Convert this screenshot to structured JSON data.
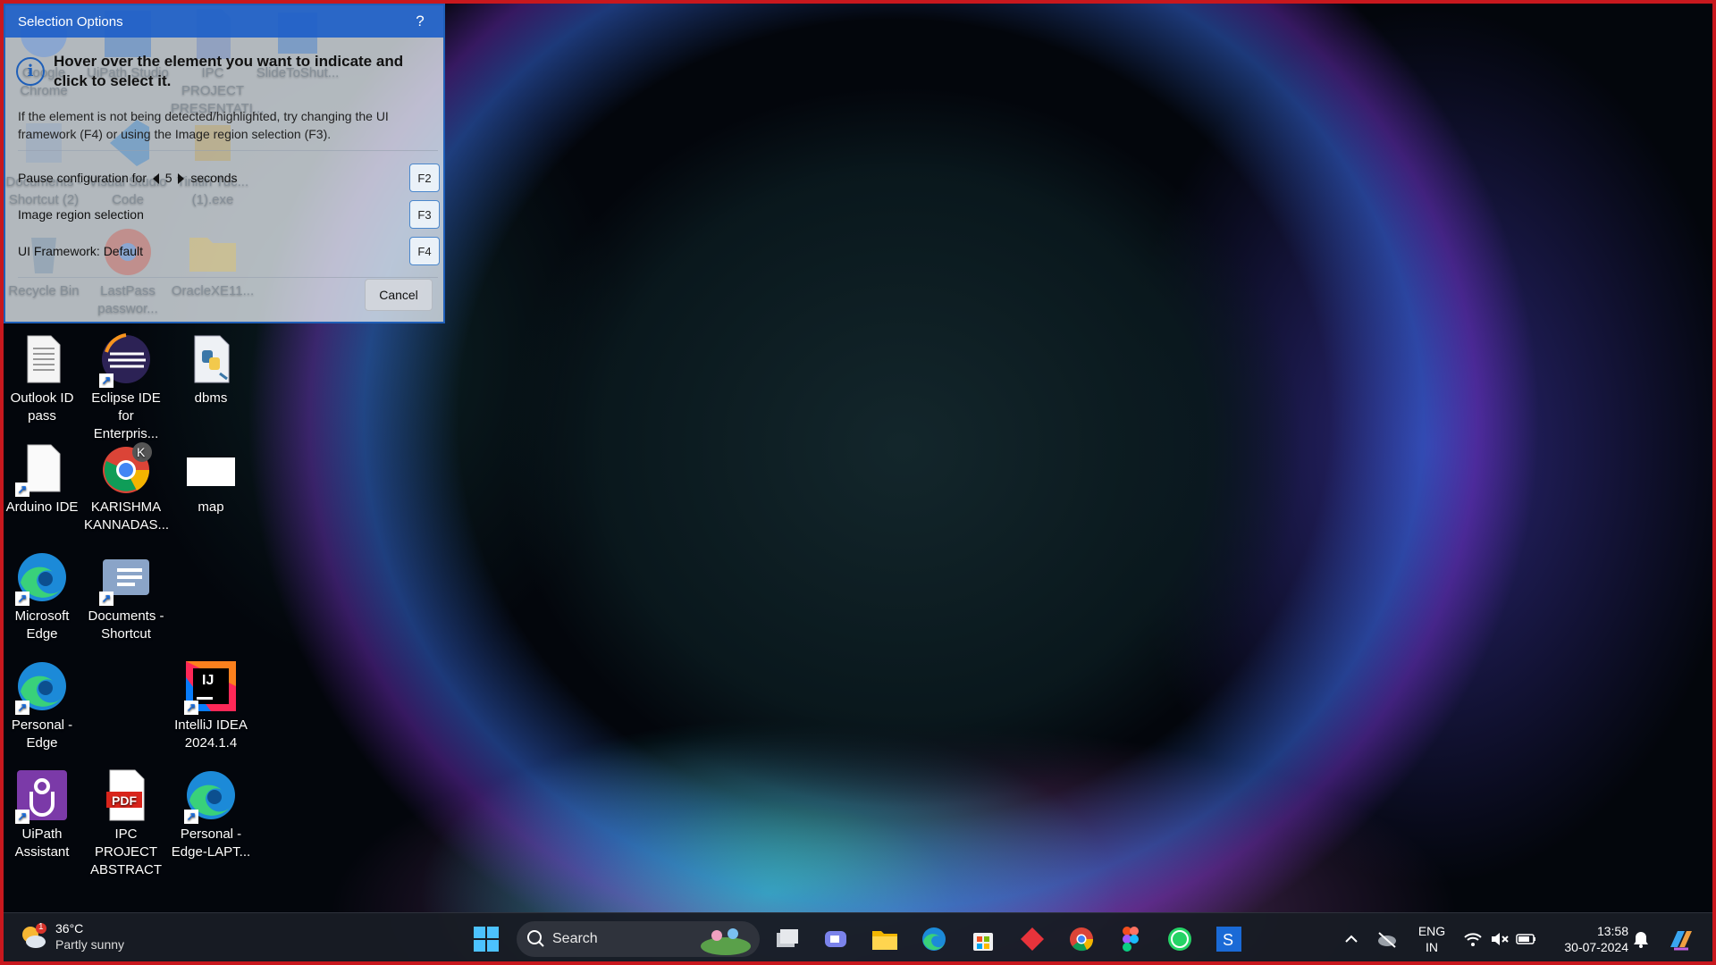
{
  "desktop": {
    "icons": [
      {
        "label": "Google Chrome",
        "icon": "chrome-icon"
      },
      {
        "label": "UiPath Studio",
        "icon": "uipath-studio-icon"
      },
      {
        "label": "IPC PROJECT PRESENTATI...",
        "icon": "pdf-icon"
      },
      {
        "label": "SlideToShut...",
        "icon": "app-icon"
      },
      {
        "label": "Documents - Shortcut (2)",
        "icon": "document-icon"
      },
      {
        "label": "Visual Studio Code",
        "icon": "vscode-icon"
      },
      {
        "label": "Tinitiri Tuc... (1).exe",
        "icon": "exe-icon"
      },
      {
        "label": "Recycle Bin",
        "icon": "recycle-bin-icon"
      },
      {
        "label": "LastPass passwor...",
        "icon": "chrome-icon"
      },
      {
        "label": "OracleXE11...",
        "icon": "folder-icon"
      },
      {
        "label": "Outlook ID pass",
        "icon": "text-file-icon"
      },
      {
        "label": "Eclipse IDE for Enterpris...",
        "icon": "eclipse-icon"
      },
      {
        "label": "dbms",
        "icon": "python-file-icon"
      },
      {
        "label": "Arduino IDE",
        "icon": "blank-file-icon"
      },
      {
        "label": "KARISHMA KANNADAS...",
        "icon": "chrome-profile-icon"
      },
      {
        "label": "map",
        "icon": "image-file-icon"
      },
      {
        "label": "Microsoft Edge",
        "icon": "edge-icon"
      },
      {
        "label": "Documents - Shortcut",
        "icon": "documents-folder-icon"
      },
      {
        "label": "Personal - Edge",
        "icon": "edge-icon"
      },
      {
        "label": "IntelliJ IDEA 2024.1.4",
        "icon": "intellij-icon"
      },
      {
        "label": "UiPath Assistant",
        "icon": "uipath-assistant-icon"
      },
      {
        "label": "IPC PROJECT ABSTRACT",
        "icon": "pdf-icon"
      },
      {
        "label": "Personal - Edge-LAPT...",
        "icon": "edge-icon"
      }
    ],
    "pdf_badge": "PDF",
    "intellij_badge": "IJ",
    "profile_badge": "K"
  },
  "dialog": {
    "title": "Selection Options",
    "help": "?",
    "instruction": "Hover over the element you want to indicate and click to select it.",
    "note": "If the element is not being detected/highlighted, try changing the UI framework (F4) or using the Image region selection (F3).",
    "pause_label": "Pause configuration for",
    "pause_value": "5",
    "pause_unit": "seconds",
    "pause_key": "F2",
    "image_region_label": "Image region selection",
    "image_region_key": "F3",
    "framework_label": "UI Framework:",
    "framework_value": "Default",
    "framework_key": "F4",
    "cancel": "Cancel"
  },
  "taskbar": {
    "weather_temp": "36°C",
    "weather_desc": "Partly sunny",
    "weather_badge": "1",
    "search_placeholder": "Search",
    "apps": [
      "start-icon",
      "task-view-icon",
      "meet-icon",
      "file-explorer-icon",
      "edge-icon",
      "store-icon",
      "app-diamond-icon",
      "chrome-icon",
      "figma-icon",
      "whatsapp-icon",
      "uipath-studio-icon"
    ],
    "lang_top": "ENG",
    "lang_bottom": "IN",
    "time": "13:58",
    "date": "30-07-2024"
  },
  "colors": {
    "accent": "#1f5fb8",
    "frame": "#c8181e",
    "taskbar": "#181c24"
  }
}
